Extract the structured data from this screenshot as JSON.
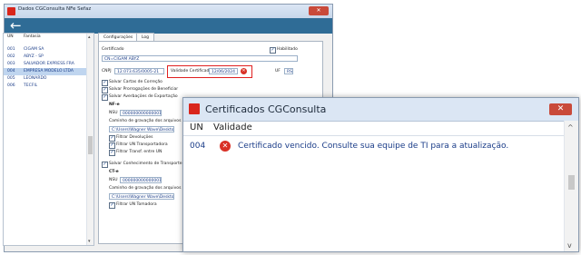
{
  "main_window": {
    "title": "Dados CGConsulta NFe Sefaz",
    "close_label": "✕",
    "back_label": "←",
    "list": {
      "headers": [
        "UN",
        "Fantasia"
      ],
      "rows": [
        {
          "un": "001",
          "name": "CIGAM SA"
        },
        {
          "un": "002",
          "name": "ABYZ - SP"
        },
        {
          "un": "003",
          "name": "SALVADOR EXPRESS FRA"
        },
        {
          "un": "004",
          "name": "EMPRESA MODELO LTDA"
        },
        {
          "un": "005",
          "name": "LEONARDO"
        },
        {
          "un": "006",
          "name": "TECFIL"
        }
      ],
      "selected_index": 3,
      "scroll_up": "▴",
      "scroll_down": "▾"
    },
    "tabs": [
      "Configurações",
      "Log"
    ],
    "form": {
      "certificado_label": "Certificado",
      "habilitado_label": "Habilitado",
      "certificado_value": "CN=CIGAM ABYZ",
      "cnpj_label": "CNPJ",
      "cnpj_value": "12.073.635/0005-21",
      "validade_label": "Validade Certificado",
      "validade_value": "12/06/2024",
      "uf_label": "UF",
      "uf_value": "RS",
      "salvar_cartas": "Salvar Cartas de Correção",
      "salvar_prorrogacoes": "Salvar Prorrogações de Beneficiar",
      "salvar_averbacoes": "Salvar Averbações de Exportação",
      "nfe_label": "NF-e",
      "nsu_label": "NSU",
      "nsu_nfe_value": "000000000000001",
      "caminho_label": "Caminho de gravação dos arquivos XML",
      "caminho_nfe_value": "C:\\Users\\Wagner Wave\\Desktop\\CG",
      "filtrar_devolucoes": "Filtrar Devoluções",
      "filtrar_un_transportadora": "Filtrar UN Transportadora",
      "filtrar_transf": "Filtrar Transf. entre UN",
      "salvar_conhecimento": "Salvar Conhecimento de Transporte",
      "cte_label": "CT-e",
      "nsu_cte_value": "000000000000001",
      "caminho_cte_value": "C:\\Users\\Wagner Wave\\Desktop\\C",
      "filtrar_un_tomadora": "Filtrar UN Tomadora",
      "error_icon": "✕"
    }
  },
  "cert_window": {
    "title": "Certificados CGConsulta",
    "close_label": "✕",
    "headers": [
      "UN",
      "Validade"
    ],
    "rows": [
      {
        "un": "004",
        "icon": "✕",
        "message": "Certificado vencido. Consulte sua equipe de TI para a atualização."
      }
    ],
    "scroll_up": "^",
    "scroll_down": "v"
  },
  "colors": {
    "accent": "#2f6c96",
    "error": "#d93025",
    "selection": "#bfd5ef"
  }
}
